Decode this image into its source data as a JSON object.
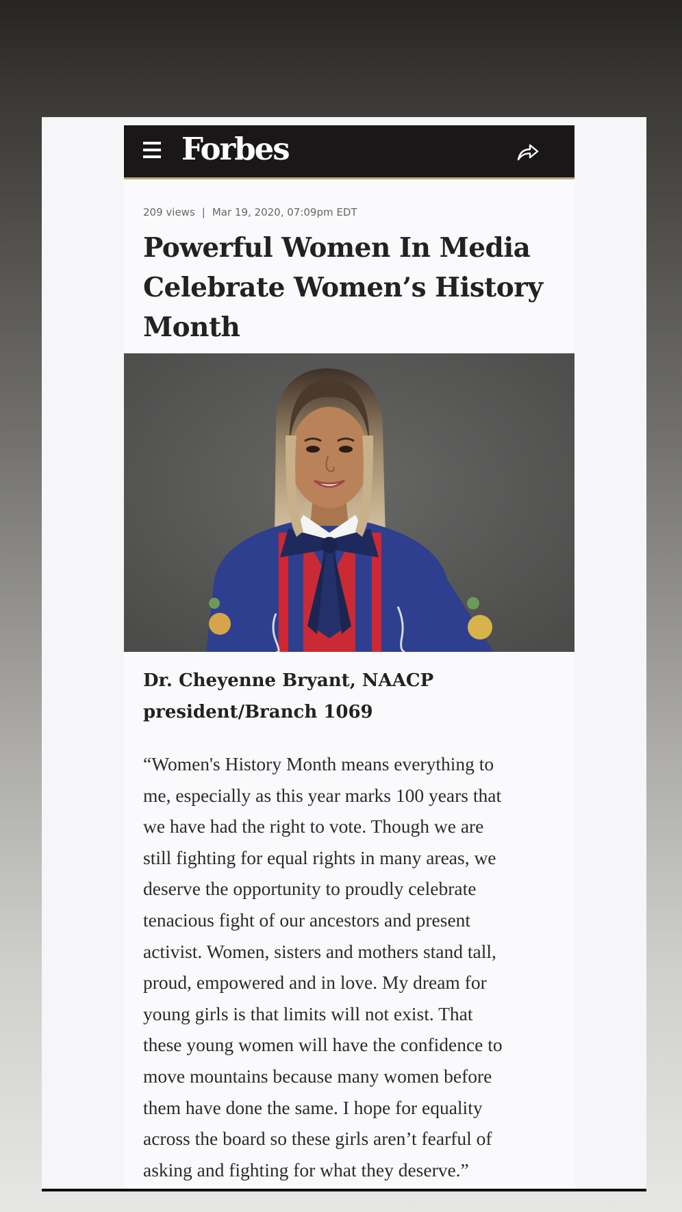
{
  "header": {
    "logo": "Forbes",
    "menu_icon": "hamburger-menu-icon",
    "share_icon": "share-arrow-icon"
  },
  "article": {
    "views": "209 views",
    "separator": "|",
    "date": "Mar 19, 2020, 07:09pm EDT",
    "headline_lines": [
      "Powerful Women In Media",
      "Celebrate Women’s History",
      "Month"
    ],
    "caption_lines": [
      "Dr. Cheyenne Bryant, NAACP",
      "president/Branch 1069"
    ],
    "quote_lines": [
      "“Women's History Month means everything to",
      "me, especially as this year marks 100 years that",
      "we have had the right to vote. Though we are",
      "still fighting for equal rights in many areas, we",
      "deserve the opportunity to proudly celebrate",
      "tenacious fight of our ancestors and present",
      "activist. Women, sisters and mothers stand tall,",
      "proud, empowered and in love. My dream for",
      "young girls is that limits will not exist. That",
      "these young women will have the confidence to",
      "move mountains because many women before",
      "them have done the same. I hope for equality",
      "across the board so these girls aren’t fearful of",
      "asking and fighting for what they deserve.”"
    ]
  },
  "colors": {
    "topbar": "#1a1718",
    "topbar_accent": "#b9a77a",
    "photo_background": "#5a5a59"
  }
}
